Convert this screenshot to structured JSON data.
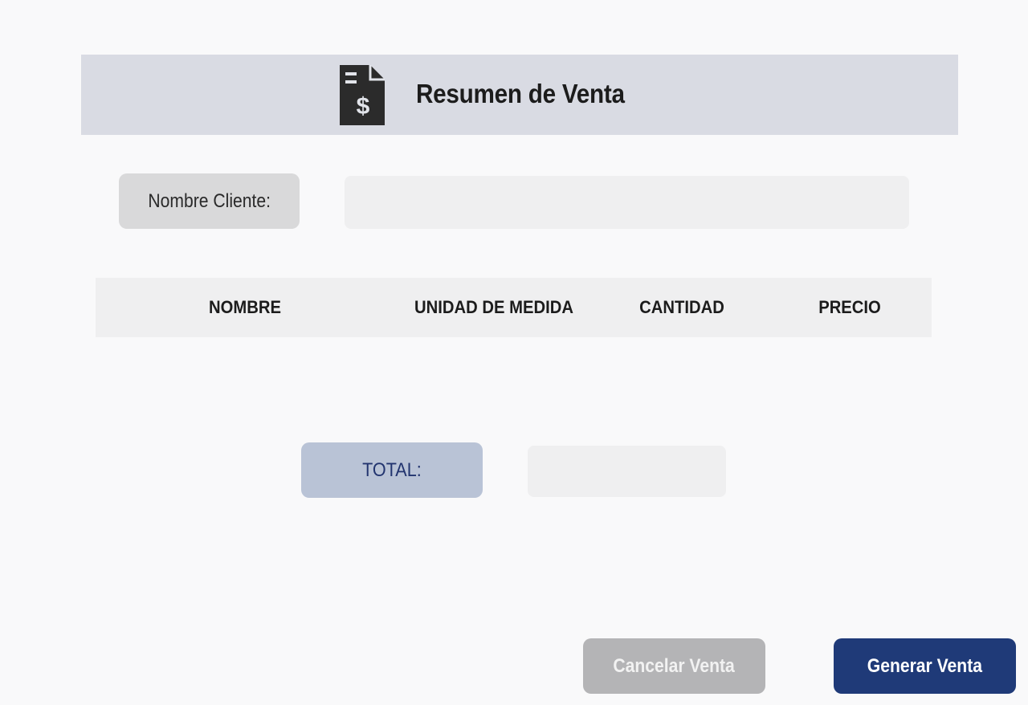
{
  "header": {
    "title": "Resumen de Venta",
    "icon": "invoice-dollar-icon"
  },
  "client": {
    "label": "Nombre Cliente:",
    "value": ""
  },
  "table": {
    "columns": [
      "NOMBRE",
      "UNIDAD DE MEDIDA",
      "CANTIDAD",
      "PRECIO"
    ],
    "rows": []
  },
  "total": {
    "label": "TOTAL:",
    "value": ""
  },
  "actions": {
    "cancel_label": "Cancelar Venta",
    "generate_label": "Generar Venta"
  },
  "colors": {
    "header_bg": "#d9dbe3",
    "total_label_bg": "#b9c3d6",
    "total_label_text": "#22346f",
    "primary_button": "#1f3a78",
    "cancel_button": "#b4b4b6"
  }
}
